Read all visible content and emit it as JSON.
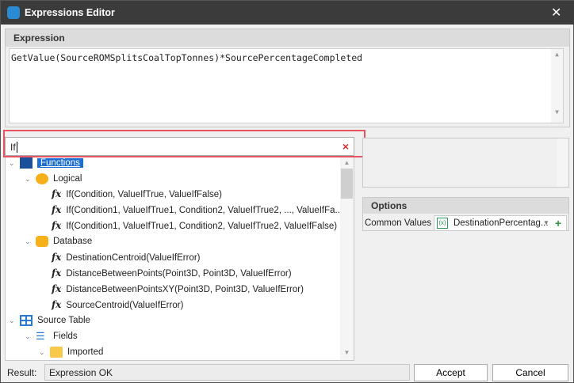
{
  "window": {
    "title": "Expressions Editor",
    "close": "✕"
  },
  "expression": {
    "header": "Expression",
    "value": "GetValue(SourceROMSplitsCoalTopTonnes)*SourcePercentageCompleted"
  },
  "search": {
    "value": "If",
    "clear": "×"
  },
  "tree": {
    "functions": "Functions",
    "logical": "Logical",
    "logical_items": [
      "If(Condition, ValueIfTrue, ValueIfFalse)",
      "If(Condition1, ValueIfTrue1, Condition2, ValueIfTrue2, ..., ValueIfFa...",
      "If(Condition1, ValueIfTrue1, Condition2, ValueIfTrue2, ValueIfFalse)"
    ],
    "database": "Database",
    "database_items": [
      "DestinationCentroid(ValueIfError)",
      "DistanceBetweenPoints(Point3D, Point3D, ValueIfError)",
      "DistanceBetweenPointsXY(Point3D, Point3D, ValueIfError)",
      "SourceCentroid(ValueIfError)"
    ],
    "source_table": "Source Table",
    "fields": "Fields",
    "imported": "Imported"
  },
  "options": {
    "header": "Options",
    "common_values_label": "Common Values",
    "common_values": "DestinationPercentag..."
  },
  "footer": {
    "result_label": "Result:",
    "result": "Expression OK",
    "accept": "Accept",
    "cancel": "Cancel"
  }
}
